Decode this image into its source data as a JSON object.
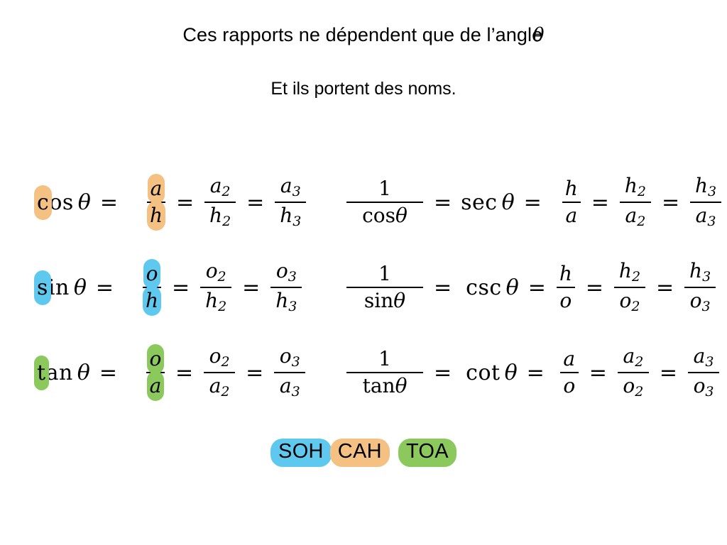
{
  "page": {
    "background": "#ffffff",
    "title_line_1": "Ces rapports ne dépendent que de l’angle",
    "title_line_1_symbol": "θ",
    "title_line_2": "Et ils portent des noms."
  },
  "colors": {
    "highlight_orange": "#F4C183",
    "highlight_cyan": "#5FC8EF",
    "highlight_green": "#8BC95C",
    "text": "#000000"
  },
  "formulas": {
    "left_column": [
      {
        "id": "cos",
        "highlight": "#F4C183",
        "func_first_letter": "c",
        "func_rest": "os",
        "theta": "θ",
        "eq1": "=",
        "frac1_num": "a",
        "frac1_den": "h",
        "eq2": "=",
        "frac2_num": "a",
        "frac2_num_sub": "2",
        "frac2_den": "h",
        "frac2_den_sub": "2",
        "eq3": "=",
        "frac3_num": "a",
        "frac3_num_sub": "3",
        "frac3_den": "h",
        "frac3_den_sub": "3"
      },
      {
        "id": "sin",
        "highlight": "#5FC8EF",
        "func_first_letter": "s",
        "func_rest": "in",
        "theta": "θ",
        "eq1": "=",
        "frac1_num": "o",
        "frac1_den": "h",
        "eq2": "=",
        "frac2_num": "o",
        "frac2_num_sub": "2",
        "frac2_den": "h",
        "frac2_den_sub": "2",
        "eq3": "=",
        "frac3_num": "o",
        "frac3_num_sub": "3",
        "frac3_den": "h",
        "frac3_den_sub": "3"
      },
      {
        "id": "tan",
        "highlight": "#8BC95C",
        "func_first_letter": "t",
        "func_rest": "an",
        "theta": "θ",
        "eq1": "=",
        "frac1_num": "o",
        "frac1_den": "a",
        "eq2": "=",
        "frac2_num": "o",
        "frac2_num_sub": "2",
        "frac2_den": "a",
        "frac2_den_sub": "2",
        "eq3": "=",
        "frac3_num": "o",
        "frac3_num_sub": "3",
        "frac3_den": "a",
        "frac3_den_sub": "3"
      }
    ],
    "right_column": [
      {
        "id": "sec",
        "recip_num": "1",
        "recip_den_func": "cos",
        "recip_den_theta": "θ",
        "eq1": "=",
        "func": "sec",
        "theta": "θ",
        "eq2": "=",
        "frac1_num": "h",
        "frac1_den": "a",
        "eq3": "=",
        "frac2_num": "h",
        "frac2_num_sub": "2",
        "frac2_den": "a",
        "frac2_den_sub": "2",
        "eq4": "=",
        "frac3_num": "h",
        "frac3_num_sub": "3",
        "frac3_den": "a",
        "frac3_den_sub": "3"
      },
      {
        "id": "csc",
        "recip_num": "1",
        "recip_den_func": "sin",
        "recip_den_theta": "θ",
        "eq1": "=",
        "func": "csc",
        "theta": "θ",
        "eq2": "=",
        "frac1_num": "h",
        "frac1_den": "o",
        "eq3": "=",
        "frac2_num": "h",
        "frac2_num_sub": "2",
        "frac2_den": "o",
        "frac2_den_sub": "2",
        "eq4": "=",
        "frac3_num": "h",
        "frac3_num_sub": "3",
        "frac3_den": "o",
        "frac3_den_sub": "3"
      },
      {
        "id": "cot",
        "recip_num": "1",
        "recip_den_func": "tan",
        "recip_den_theta": "θ",
        "eq1": "=",
        "func": "cot",
        "theta": "θ",
        "eq2": "=",
        "frac1_num": "a",
        "frac1_den": "o",
        "eq3": "=",
        "frac2_num": "a",
        "frac2_num_sub": "2",
        "frac2_den": "o",
        "frac2_den_sub": "2",
        "eq4": "=",
        "frac3_num": "a",
        "frac3_num_sub": "3",
        "frac3_den": "o",
        "frac3_den_sub": "3"
      }
    ]
  },
  "mnemonic": {
    "items": [
      {
        "label": "SOH",
        "color": "#5FC8EF"
      },
      {
        "label": "CAH",
        "color": "#F4C183"
      },
      {
        "label": "TOA",
        "color": "#8BC95C"
      }
    ]
  }
}
